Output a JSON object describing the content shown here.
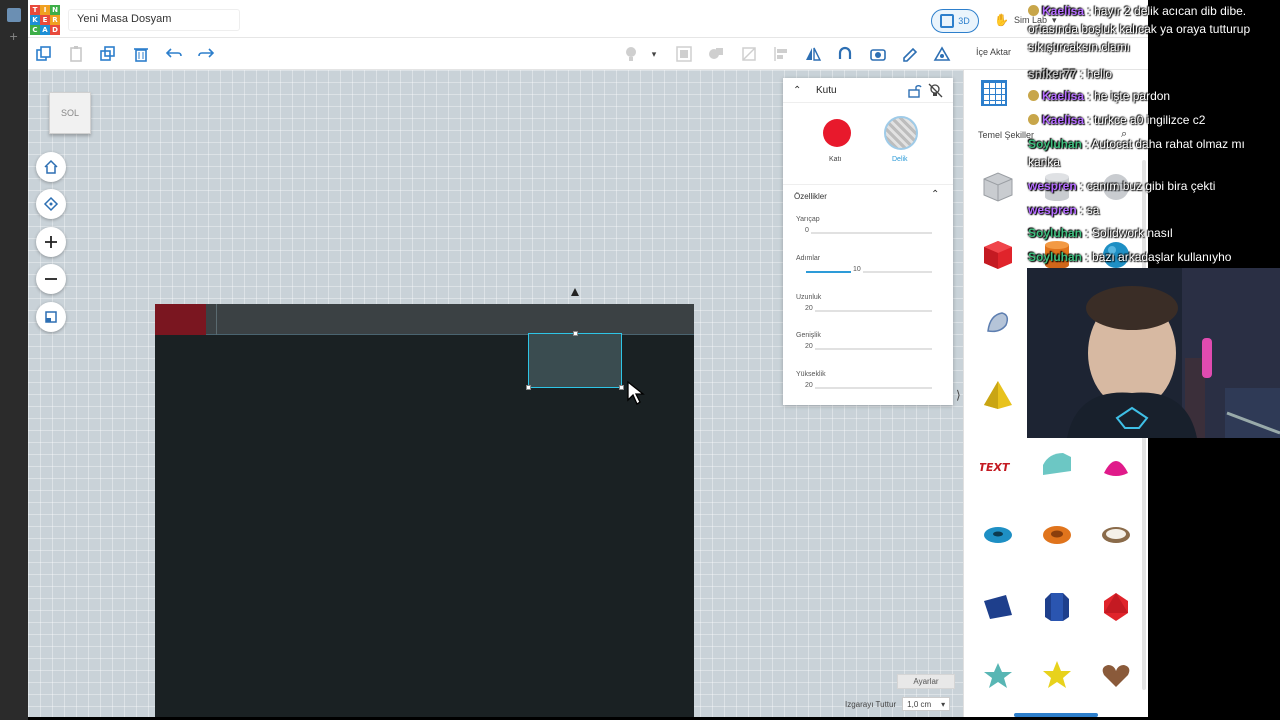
{
  "app": {
    "document_title": "Yeni Masa Dosyam",
    "logo_letters": [
      "T",
      "I",
      "N",
      "K",
      "E",
      "R",
      "C",
      "A",
      "D"
    ],
    "mode_3d_label": "3D",
    "sim_lab_label": "Sim Lab",
    "import_label": "İçe Aktar"
  },
  "workplane": {
    "view_cube_label": "SOL",
    "settings_label": "Ayarlar",
    "snap_label": "Izgarayı Tuttur",
    "snap_value": "1,0 cm"
  },
  "inspector": {
    "title": "Kutu",
    "solid_label": "Katı",
    "hole_label": "Delik",
    "properties_label": "Özellikler",
    "props": [
      {
        "label": "Yarıçap",
        "value": "0",
        "fraction": 0.0
      },
      {
        "label": "Adımlar",
        "value": "10",
        "fraction": 0.38
      },
      {
        "label": "Uzunluk",
        "value": "20",
        "fraction": 0.0
      },
      {
        "label": "Genişlik",
        "value": "20",
        "fraction": 0.0
      },
      {
        "label": "Yükseklik",
        "value": "20",
        "fraction": 0.0
      }
    ]
  },
  "shapes_panel": {
    "category": "Temel Şekiller",
    "items": [
      "box-hole",
      "cylinder-hole",
      "sphere-hole",
      "box",
      "cylinder",
      "sphere",
      "scribble",
      "pyramid",
      "roof",
      "cone",
      "text",
      "round-roof",
      "paraboloid",
      "torus",
      "tube",
      "ring",
      "wedge",
      "polygon",
      "icosahedron",
      "star",
      "star-yellow",
      "heart"
    ]
  },
  "chat": [
    {
      "user": "Kaelisa",
      "color": "#b56cff",
      "badge": true,
      "text": " : hayır 2 delik acıcan dib dibe. ortasında boşluk kalıcak ya oraya tutturup sıkıştırcaksın.clamı"
    },
    {
      "user": "sniker77",
      "color": "#bfbfbf",
      "badge": false,
      "text": " : hello"
    },
    {
      "user": "Kaelisa",
      "color": "#b56cff",
      "badge": true,
      "text": " : he işte pardon"
    },
    {
      "user": "Kaelisa",
      "color": "#b56cff",
      "badge": true,
      "text": " : turkce a0 ingilizce c2"
    },
    {
      "user": "Soyluhan",
      "color": "#3fbf7f",
      "badge": false,
      "text": " : Autocat daha rahat olmaz mı kanka"
    },
    {
      "user": "wespren",
      "color": "#b56cff",
      "badge": false,
      "text": " : canım buz gibi bira çekti"
    },
    {
      "user": "wespren",
      "color": "#b56cff",
      "badge": false,
      "text": " : sa"
    },
    {
      "user": "Soyluhan",
      "color": "#3fbf7f",
      "badge": false,
      "text": " : Solidwork nasıl"
    },
    {
      "user": "Soyluhan",
      "color": "#3fbf7f",
      "badge": false,
      "text": " : bazı arkadaşlar kullanıyho"
    }
  ],
  "colors": {
    "accent": "#2d7fcc",
    "solid_red": "#e8192c",
    "workplane_dark": "#1a2123",
    "selection": "#2ec5e6"
  }
}
